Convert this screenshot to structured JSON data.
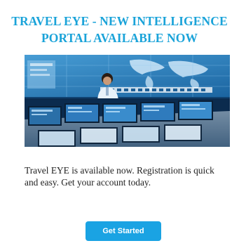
{
  "headline": {
    "line1": "TRAVEL EYE - NEW INTELLIGENCE",
    "line2": "PORTAL AVAILABLE NOW"
  },
  "hero_image": {
    "subject": "operator-at-monitoring-control-room"
  },
  "body": {
    "line1": "Travel EYE is available now. Registration is quick",
    "line2": "and easy.  Get your account today."
  },
  "cta": {
    "label": "Get Started"
  },
  "colors": {
    "headline": "#1aa3d9",
    "button": "#1aa3e3",
    "button_text": "#ffffff",
    "body_text": "#222222"
  }
}
